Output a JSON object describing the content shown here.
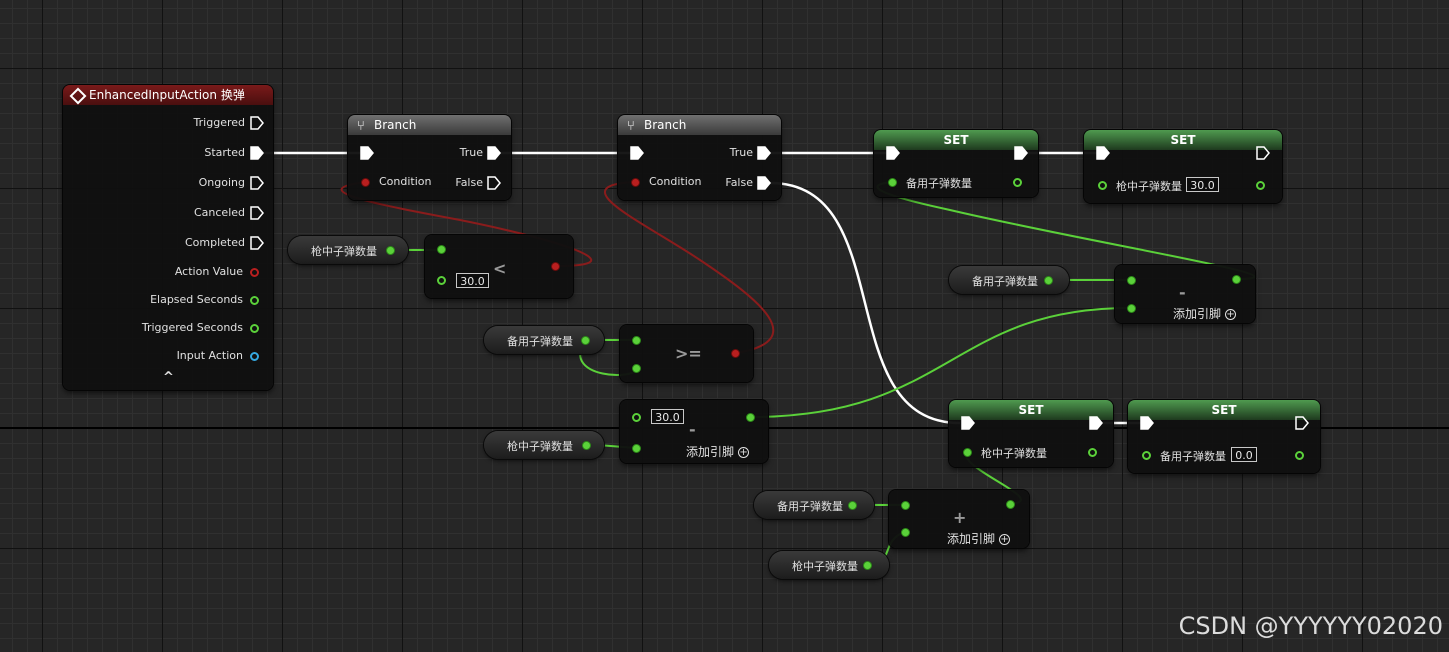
{
  "event_node": {
    "title": "EnhancedInputAction 换弹",
    "pins": [
      "Triggered",
      "Started",
      "Ongoing",
      "Canceled",
      "Completed",
      "Action Value",
      "Elapsed Seconds",
      "Triggered Seconds",
      "Input Action"
    ],
    "collapse": "^"
  },
  "branch_1": {
    "title": "Branch",
    "condition": "Condition",
    "true_label": "True",
    "false_label": "False"
  },
  "branch_2": {
    "title": "Branch",
    "condition": "Condition",
    "true_label": "True",
    "false_label": "False"
  },
  "vars": {
    "magazine": "枪中子弹数量",
    "reserve": "备用子弹数量"
  },
  "less_node": {
    "value": "30.0",
    "op": "<"
  },
  "gte_node": {
    "op": ">="
  },
  "minus_node_1": {
    "value": "30.0",
    "op": "-",
    "add_pin": "添加引脚"
  },
  "minus_node_2": {
    "op": "-",
    "add_pin": "添加引脚"
  },
  "plus_node": {
    "op": "+",
    "add_pin": "添加引脚"
  },
  "set_1": {
    "title": "SET",
    "pin": "备用子弹数量"
  },
  "set_2": {
    "title": "SET",
    "pin": "枪中子弹数量",
    "value": "30.0"
  },
  "set_3": {
    "title": "SET",
    "pin": "枪中子弹数量"
  },
  "set_4": {
    "title": "SET",
    "pin": "备用子弹数量",
    "value": "0.0"
  },
  "watermark": "CSDN @YYYYYY02020",
  "colors": {
    "exec": "#ffffff",
    "float": "#5bd13a",
    "bool": "#b81f1f",
    "object": "#35a8e0",
    "event_header": "#7a1a1a",
    "set_header": "#4f9a4f"
  }
}
